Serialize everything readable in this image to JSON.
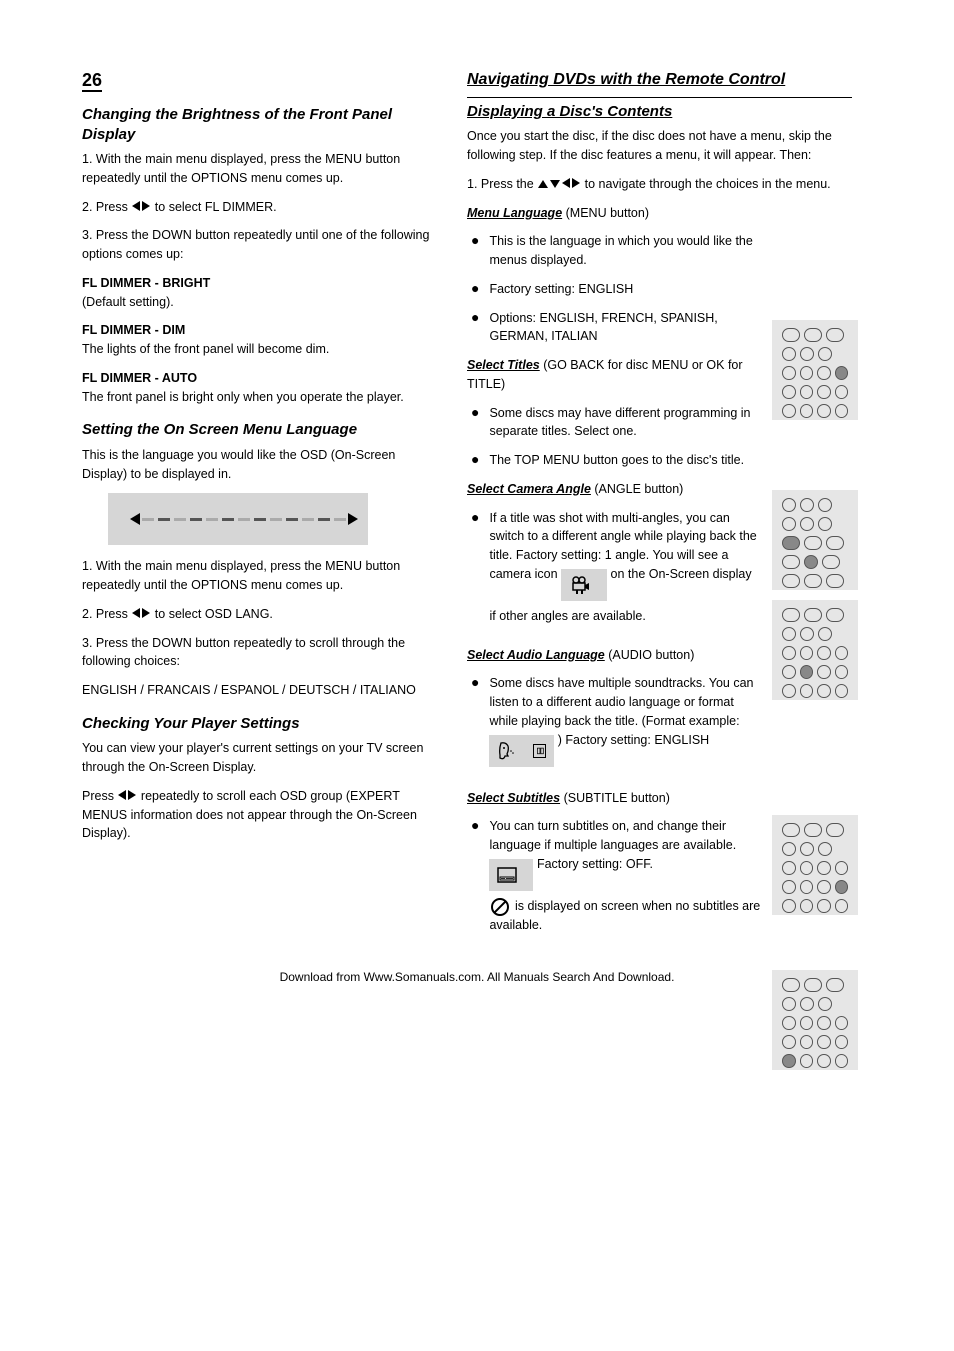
{
  "page_number": "26",
  "left": {
    "heading1": "Changing the Brightness of the Front Panel Display",
    "body1": "1. With the main menu displayed, press the MENU button repeatedly until the OPTIONS menu comes up.",
    "body2a": "2. Press ",
    "body2b": " to select FL DIMMER.",
    "body3": "3. Press the DOWN button repeatedly until one of the following options comes up:",
    "list1_1_label": "FL DIMMER - BRIGHT",
    "list1_1_body": "(Default setting).",
    "list1_2_label": "FL DIMMER - DIM",
    "list1_2_body": "The lights of the front panel will become dim.",
    "list1_3_label": "FL DIMMER - AUTO",
    "list1_3_body": "The front panel is bright only when you operate the player.",
    "heading2": "Setting the On Screen Menu Language",
    "body4": "This is the language you would like the OSD (On-Screen Display) to be displayed in.",
    "body5": "1. With the main menu displayed, press the MENU button repeatedly until the OPTIONS menu comes up.",
    "body6a": "2. Press ",
    "body6b": " to select OSD LANG.",
    "body7": "3. Press the DOWN button repeatedly to scroll through the following choices:",
    "opts": "ENGLISH / FRANCAIS / ESPANOL / DEUTSCH / ITALIANO",
    "heading3": "Checking Your Player Settings",
    "body8": "You can view your player's current settings on your TV screen through the On-Screen Display.",
    "body9a": "Press ",
    "body9b": " repeatedly to scroll each OSD group (EXPERT MENUS information does not appear through the On-Screen Display)."
  },
  "right": {
    "heading1": "Navigating DVDs with the Remote Control",
    "heading1b": "Displaying a Disc's Contents",
    "body1": "Once you start the disc, if the disc does not have a menu, skip the following step. If the disc features a menu, it will appear. Then:",
    "body2a": "1. Press the ",
    "body2b": " to navigate through the choices in the menu.",
    "sub1_label": "Menu Language",
    "sub1_body": " (MENU button)",
    "bul1": "This is the language in which you would like the menus displayed.",
    "bul2": "Factory setting: ENGLISH",
    "bul3": "Options: ENGLISH, FRENCH, SPANISH, GERMAN, ITALIAN",
    "sub2_label": "Select Titles",
    "sub2_body": " (GO BACK for disc MENU or OK for TITLE)",
    "bul4": "Some discs may have different programming in separate titles. Select one.",
    "bul5": "The TOP MENU button goes to the disc's title.",
    "sub3_label": "Select Camera Angle",
    "sub3_body": " (ANGLE button)",
    "bul6a": "If a title was shot with multi-angles, you can switch to a different angle while playing back the title. Factory setting: 1 angle. You will see a camera icon ",
    "bul6b": " on the On-Screen display if other angles are available.",
    "sub4_label": "Select Audio Language",
    "sub4_body": " (AUDIO button)",
    "bul7a": "Some discs have multiple soundtracks. You can listen to a different audio language or format while playing back the title. (Format example: ",
    "bul7b": " ) Factory setting: ENGLISH",
    "sub5_label": "Select Subtitles",
    "sub5_body": " (SUBTITLE button)",
    "bul8a": "You can turn subtitles on, and change their language if multiple languages are available. ",
    "bul8b": " Factory setting: OFF.",
    "bul8c": " is displayed on screen when no subtitles are available."
  },
  "footer": "Download from Www.Somanuals.com. All Manuals Search And Download."
}
